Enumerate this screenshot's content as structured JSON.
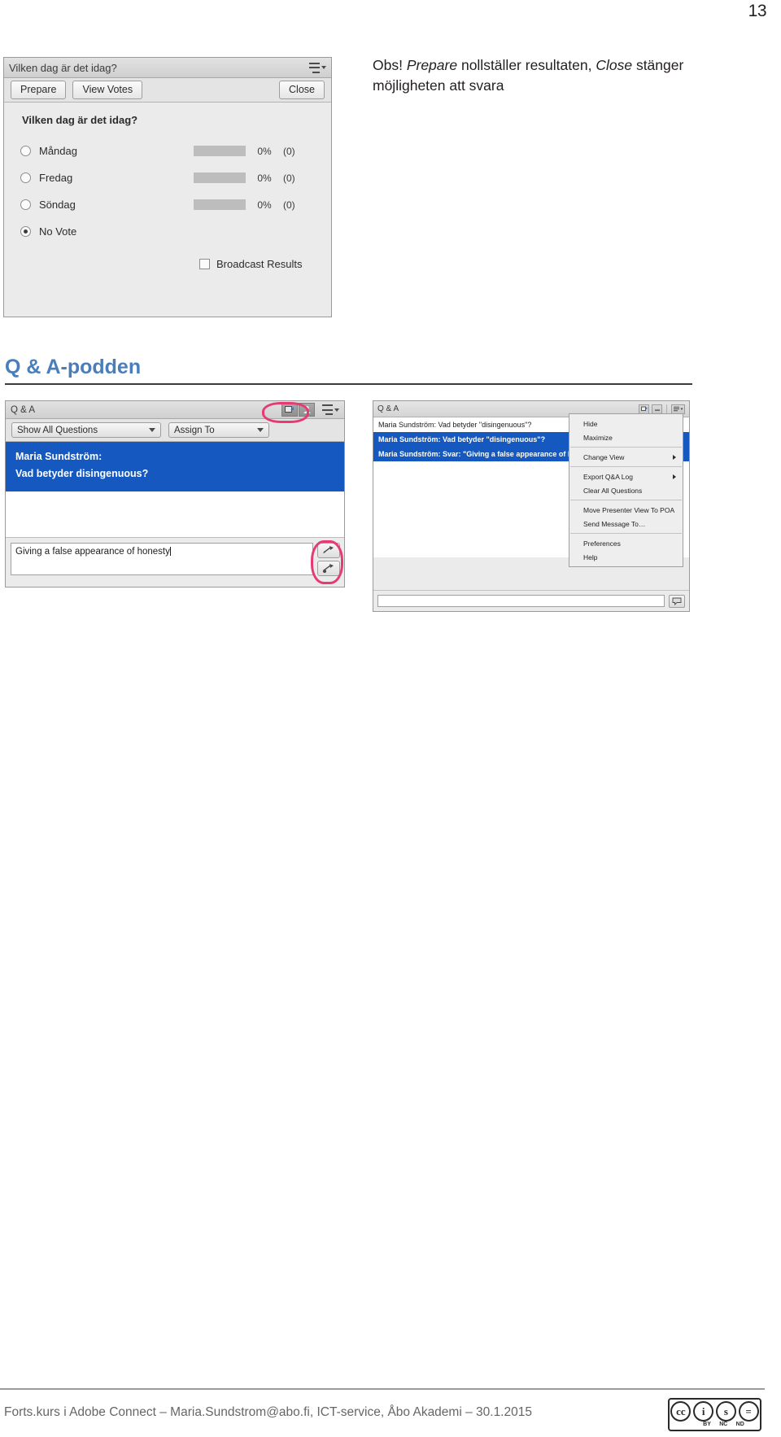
{
  "page": {
    "number": "13"
  },
  "poll": {
    "title": "Vilken dag är det idag?",
    "menu_icon": "hamburger-menu-icon",
    "buttons": {
      "prepare": "Prepare",
      "view_votes": "View Votes",
      "close": "Close"
    },
    "question": "Vilken dag är det idag?",
    "options": [
      {
        "label": "Måndag",
        "percent": "0%",
        "count": "(0)",
        "selected": false
      },
      {
        "label": "Fredag",
        "percent": "0%",
        "count": "(0)",
        "selected": false
      },
      {
        "label": "Söndag",
        "percent": "0%",
        "count": "(0)",
        "selected": false
      }
    ],
    "no_vote": {
      "label": "No Vote",
      "selected": true
    },
    "broadcast": {
      "label": "Broadcast Results",
      "checked": false
    }
  },
  "note": {
    "prefix": "Obs! ",
    "em1": "Prepare",
    "mid": " nollställer resultaten, ",
    "em2": "Close",
    "suffix": " stänger möjligheten att svara"
  },
  "section": {
    "heading": "Q & A-podden"
  },
  "qa_left": {
    "title": "Q & A",
    "icons": {
      "first": "share-question-icon",
      "second": "person-icon",
      "menu": "hamburger-menu-icon"
    },
    "filters": {
      "show": "Show All Questions",
      "assign": "Assign To"
    },
    "selected_question": {
      "author": "Maria Sundström:",
      "text": "Vad betyder disingenuous?"
    },
    "answer_input": {
      "value": "Giving a false appearance of honesty"
    },
    "send_buttons": {
      "top": "send-answer-icon",
      "bottom": "send-to-all-icon"
    }
  },
  "qa_right": {
    "title": "Q & A",
    "rows": [
      {
        "text": "Maria Sundström: Vad betyder \"disingenuous\"?",
        "selected": false
      },
      {
        "text": "Maria Sundström: Vad betyder \"disingenuous\"?",
        "selected": true
      },
      {
        "text": "Maria Sundström: Svar: \"Giving a false appearance of honesty\"",
        "selected": true
      }
    ],
    "controls": {
      "one": "share-icon",
      "two": "minimize-icon",
      "three": "menu-icon"
    },
    "send_icon": "send-message-icon"
  },
  "context_menu": {
    "groups": [
      [
        {
          "label": "Hide",
          "submenu": false
        },
        {
          "label": "Maximize",
          "submenu": false
        }
      ],
      [
        {
          "label": "Change View",
          "submenu": true
        }
      ],
      [
        {
          "label": "Export Q&A Log",
          "submenu": true
        },
        {
          "label": "Clear All Questions",
          "submenu": false
        }
      ],
      [
        {
          "label": "Move Presenter View To POA",
          "submenu": false
        },
        {
          "label": "Send Message To…",
          "submenu": false
        }
      ],
      [
        {
          "label": "Preferences",
          "submenu": false
        },
        {
          "label": "Help",
          "submenu": false
        }
      ]
    ]
  },
  "footer": {
    "text": "Forts.kurs i Adobe Connect – Maria.Sundstrom@abo.fi, ICT-service, Åbo Akademi – 30.1.2015",
    "license": {
      "name": "creative-commons-by-nc-nd",
      "marks": [
        "cc",
        "i",
        "s",
        "="
      ],
      "sub": [
        "BY",
        "NC",
        "ND"
      ]
    }
  },
  "colors": {
    "accent": "#4a7ebb",
    "selection": "#1559c0",
    "highlight_ring": "#e53b73"
  }
}
